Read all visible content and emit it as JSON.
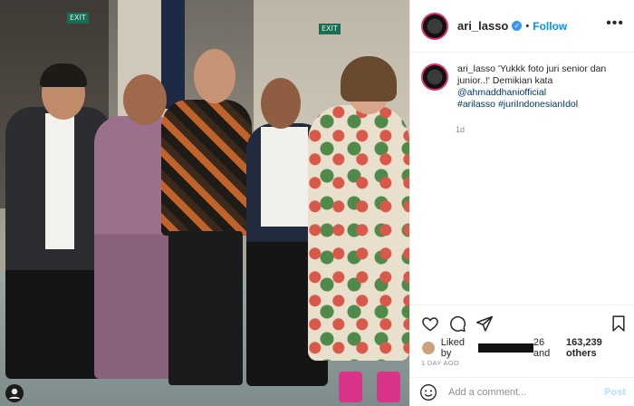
{
  "post": {
    "username": "ari_lasso",
    "follow_label": "Follow",
    "more_glyph": "•••",
    "verified_glyph": "✓",
    "caption": {
      "username": "ari_lasso",
      "text": "'Yukkk foto juri senior dan junior..!' Demikian kata",
      "mention": "@ahmaddhaniofficial",
      "hashtags": "#arilasso #juriIndonesianIdol",
      "time": "1d"
    },
    "likes": {
      "prefix": "Liked by",
      "suffix": "26 and",
      "count": "163,239 others"
    },
    "posted_ago": "1 DAY AGO",
    "comment_placeholder": "Add a comment...",
    "post_label": "Post"
  },
  "photo": {
    "exit_signs": [
      "EXIT",
      "EXIT"
    ]
  },
  "icons": {
    "like": "heart-icon",
    "comment": "comment-icon",
    "share": "send-icon",
    "save": "bookmark-icon",
    "emoji": "emoji-icon"
  },
  "colors": {
    "follow": "#0095f6",
    "avatar_ring": "#e1306c",
    "link": "#00376b",
    "meta": "#8e8e8e"
  }
}
